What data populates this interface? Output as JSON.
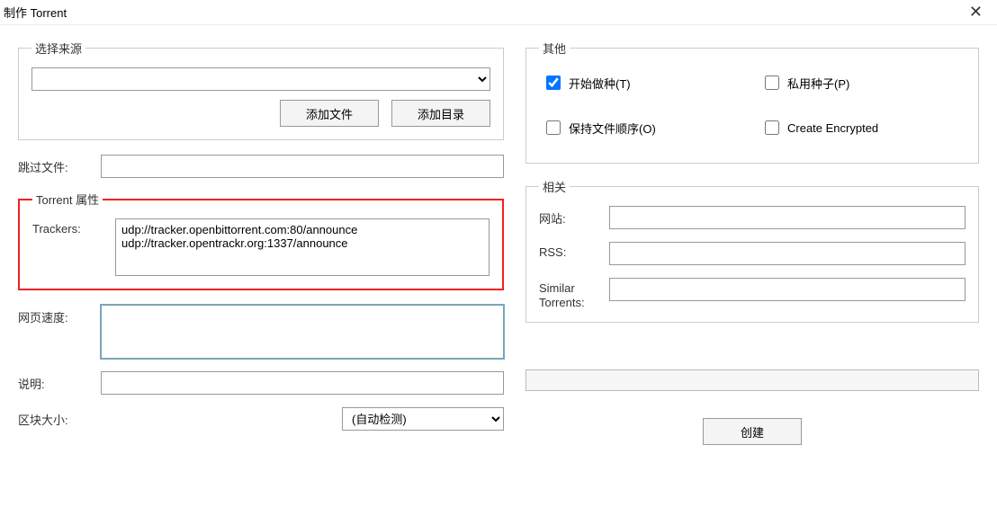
{
  "window": {
    "title": "制作 Torrent"
  },
  "source": {
    "legend": "选择来源",
    "value": "",
    "add_file_label": "添加文件",
    "add_dir_label": "添加目录"
  },
  "skip": {
    "label": "跳过文件:",
    "value": ""
  },
  "properties": {
    "legend": "Torrent 属性",
    "trackers_label": "Trackers:",
    "trackers_value": "udp://tracker.openbittorrent.com:80/announce\nudp://tracker.opentrackr.org:1337/announce"
  },
  "webspeed": {
    "label": "网页速度:",
    "value": ""
  },
  "description": {
    "label": "说明:",
    "value": ""
  },
  "blocksize": {
    "label": "区块大小:",
    "selected": "(自动检测)"
  },
  "other": {
    "legend": "其他",
    "start_seeding": {
      "label": "开始做种(T)",
      "checked": true
    },
    "private": {
      "label": "私用种子(P)",
      "checked": false
    },
    "preserve_order": {
      "label": "保持文件顺序(O)",
      "checked": false
    },
    "create_encrypted": {
      "label": "Create Encrypted",
      "checked": false
    }
  },
  "related": {
    "legend": "相关",
    "website_label": "网站:",
    "website_value": "",
    "rss_label": "RSS:",
    "rss_value": "",
    "similar_label": "Similar Torrents:",
    "similar_value": ""
  },
  "create_button": "创建"
}
